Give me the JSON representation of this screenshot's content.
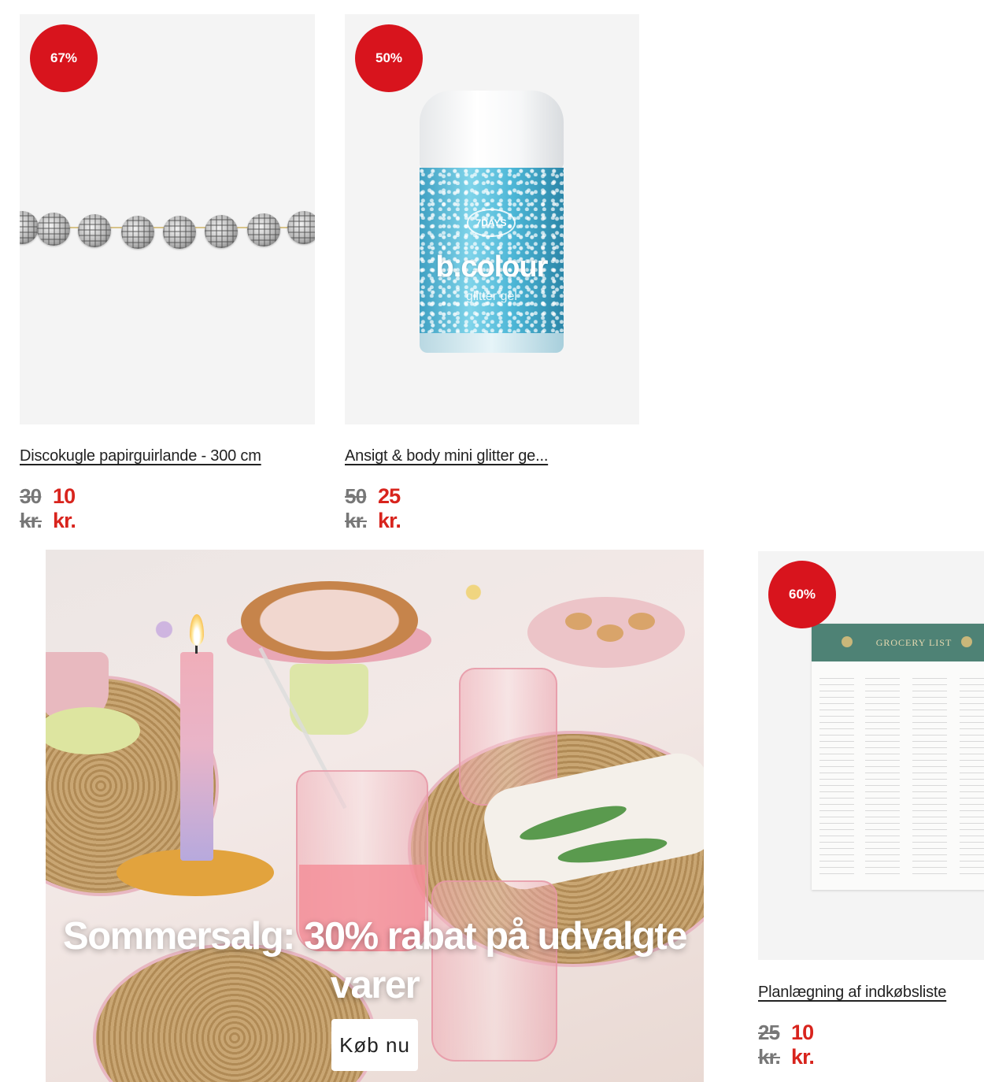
{
  "products": [
    {
      "badge": "67%",
      "title": "Discokugle papirguirlande - 300 cm",
      "old_price": "30 kr.",
      "new_price": "10 kr."
    },
    {
      "badge": "50%",
      "title": "Ansigt & body mini glitter ge...",
      "old_price": "50 kr.",
      "new_price": "25 kr.",
      "image_text": {
        "brand": "7DAYS",
        "logo": "b.colour",
        "sub": "glitter gel"
      }
    },
    {
      "badge": "60%",
      "title": "Planlægning af indkøbsliste",
      "old_price": "25 kr.",
      "new_price": "10 kr.",
      "image_text": {
        "header": "GROCERY LIST"
      }
    }
  ],
  "banner": {
    "headline": "Sommersalg: 30% rabat på udvalgte varer",
    "cta": "Køb nu"
  },
  "colors": {
    "badge": "#d8141d",
    "sale_price": "#d8241d",
    "old_price": "#777777",
    "image_bg": "#f4f4f4"
  }
}
